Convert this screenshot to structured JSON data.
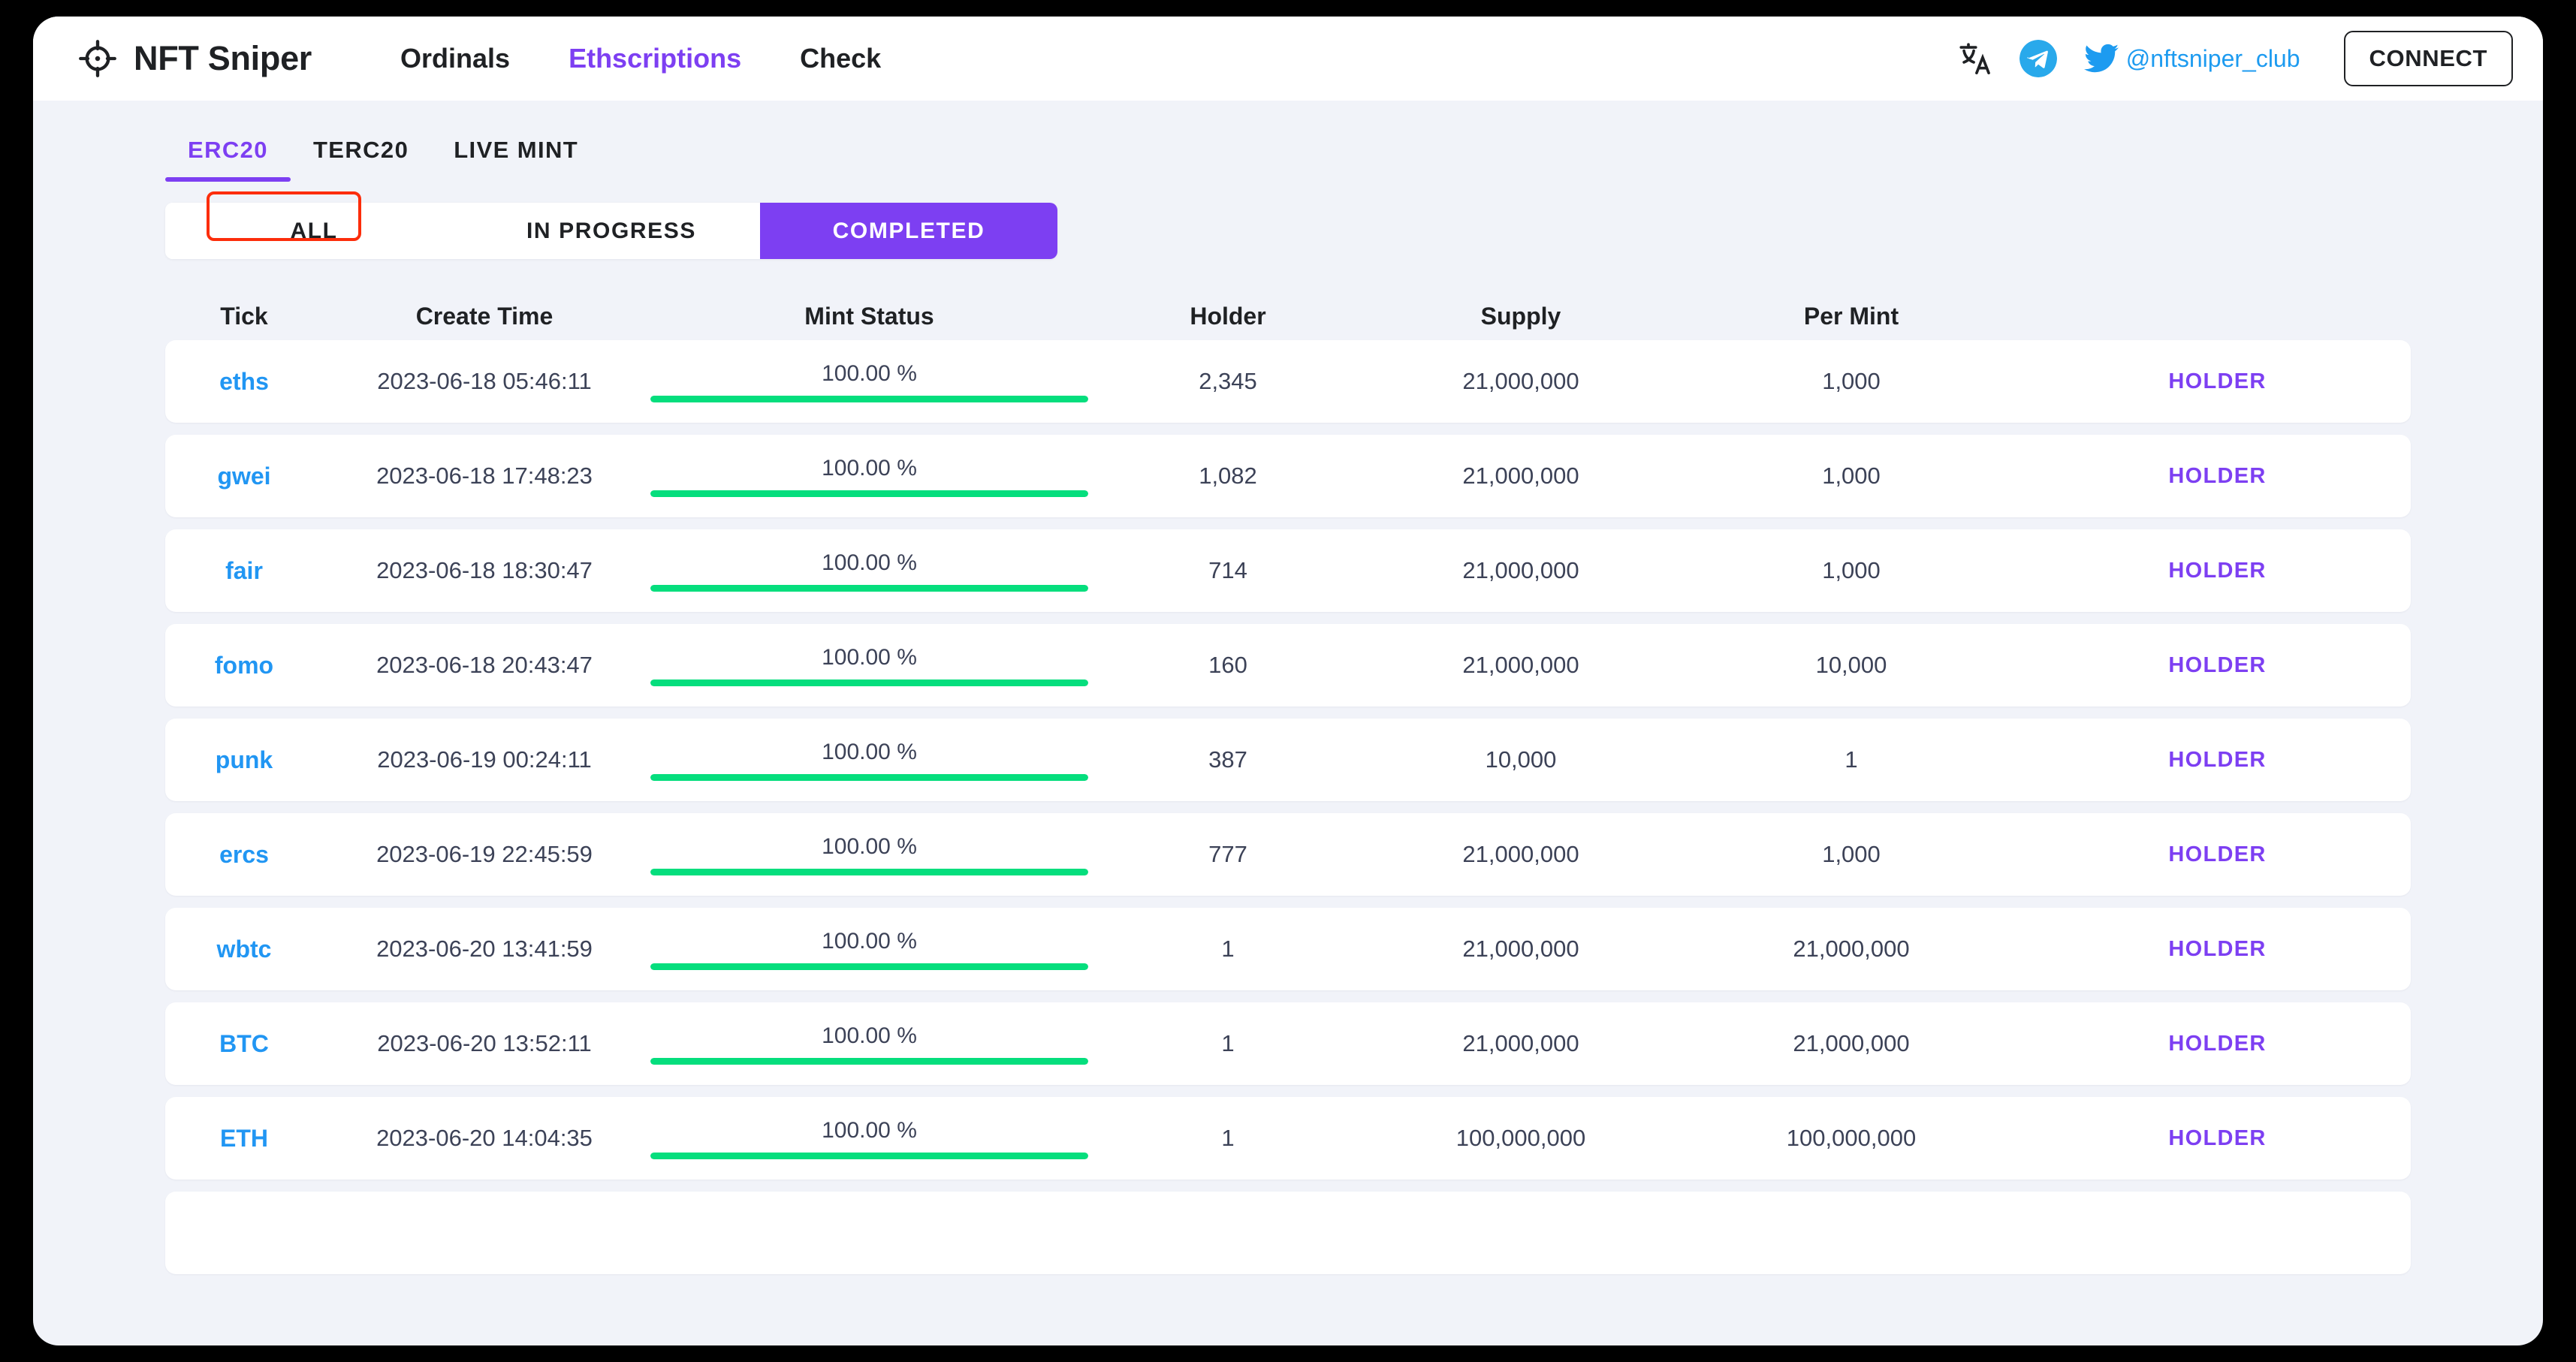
{
  "brand": {
    "name": "NFT Sniper",
    "logo_icon": "crosshair-icon"
  },
  "nav": [
    {
      "label": "Ordinals",
      "active": false
    },
    {
      "label": "Ethscriptions",
      "active": true
    },
    {
      "label": "Check",
      "active": false
    }
  ],
  "header_right": {
    "translate_icon": "translate-icon",
    "telegram_icon": "telegram-icon",
    "twitter_icon": "twitter-icon",
    "twitter_handle": "@nftsniper_club",
    "connect_label": "CONNECT"
  },
  "tabs": [
    {
      "label": "ERC20",
      "active": true
    },
    {
      "label": "TERC20",
      "active": false
    },
    {
      "label": "LIVE MINT",
      "active": false
    }
  ],
  "filters": [
    {
      "label": "ALL",
      "active": false
    },
    {
      "label": "IN PROGRESS",
      "active": false
    },
    {
      "label": "COMPLETED",
      "active": true
    }
  ],
  "table": {
    "columns": [
      "Tick",
      "Create Time",
      "Mint Status",
      "Holder",
      "Supply",
      "Per Mint",
      ""
    ],
    "action_label": "HOLDER",
    "rows": [
      {
        "tick": "eths",
        "create_time": "2023-06-18 05:46:11",
        "percent": "100.00 %",
        "percent_value": 100,
        "holder": "2,345",
        "supply": "21,000,000",
        "per_mint": "1,000",
        "action": "HOLDER"
      },
      {
        "tick": "gwei",
        "create_time": "2023-06-18 17:48:23",
        "percent": "100.00 %",
        "percent_value": 100,
        "holder": "1,082",
        "supply": "21,000,000",
        "per_mint": "1,000",
        "action": "HOLDER"
      },
      {
        "tick": "fair",
        "create_time": "2023-06-18 18:30:47",
        "percent": "100.00 %",
        "percent_value": 100,
        "holder": "714",
        "supply": "21,000,000",
        "per_mint": "1,000",
        "action": "HOLDER"
      },
      {
        "tick": "fomo",
        "create_time": "2023-06-18 20:43:47",
        "percent": "100.00 %",
        "percent_value": 100,
        "holder": "160",
        "supply": "21,000,000",
        "per_mint": "10,000",
        "action": "HOLDER"
      },
      {
        "tick": "punk",
        "create_time": "2023-06-19 00:24:11",
        "percent": "100.00 %",
        "percent_value": 100,
        "holder": "387",
        "supply": "10,000",
        "per_mint": "1",
        "action": "HOLDER"
      },
      {
        "tick": "ercs",
        "create_time": "2023-06-19 22:45:59",
        "percent": "100.00 %",
        "percent_value": 100,
        "holder": "777",
        "supply": "21,000,000",
        "per_mint": "1,000",
        "action": "HOLDER"
      },
      {
        "tick": "wbtc",
        "create_time": "2023-06-20 13:41:59",
        "percent": "100.00 %",
        "percent_value": 100,
        "holder": "1",
        "supply": "21,000,000",
        "per_mint": "21,000,000",
        "action": "HOLDER"
      },
      {
        "tick": "BTC",
        "create_time": "2023-06-20 13:52:11",
        "percent": "100.00 %",
        "percent_value": 100,
        "holder": "1",
        "supply": "21,000,000",
        "per_mint": "21,000,000",
        "action": "HOLDER"
      },
      {
        "tick": "ETH",
        "create_time": "2023-06-20 14:04:35",
        "percent": "100.00 %",
        "percent_value": 100,
        "holder": "1",
        "supply": "100,000,000",
        "per_mint": "100,000,000",
        "action": "HOLDER"
      },
      {
        "tick": "",
        "create_time": "",
        "percent": "",
        "percent_value": 0,
        "holder": "",
        "supply": "",
        "per_mint": "",
        "action": ""
      }
    ]
  },
  "colors": {
    "accent_purple": "#7d3ff2",
    "link_blue": "#2196f3",
    "progress_green": "#05de7d",
    "page_bg": "#f1f3f9",
    "annotation_red": "#fc2d0b",
    "twitter_blue": "#1d9bf0"
  }
}
